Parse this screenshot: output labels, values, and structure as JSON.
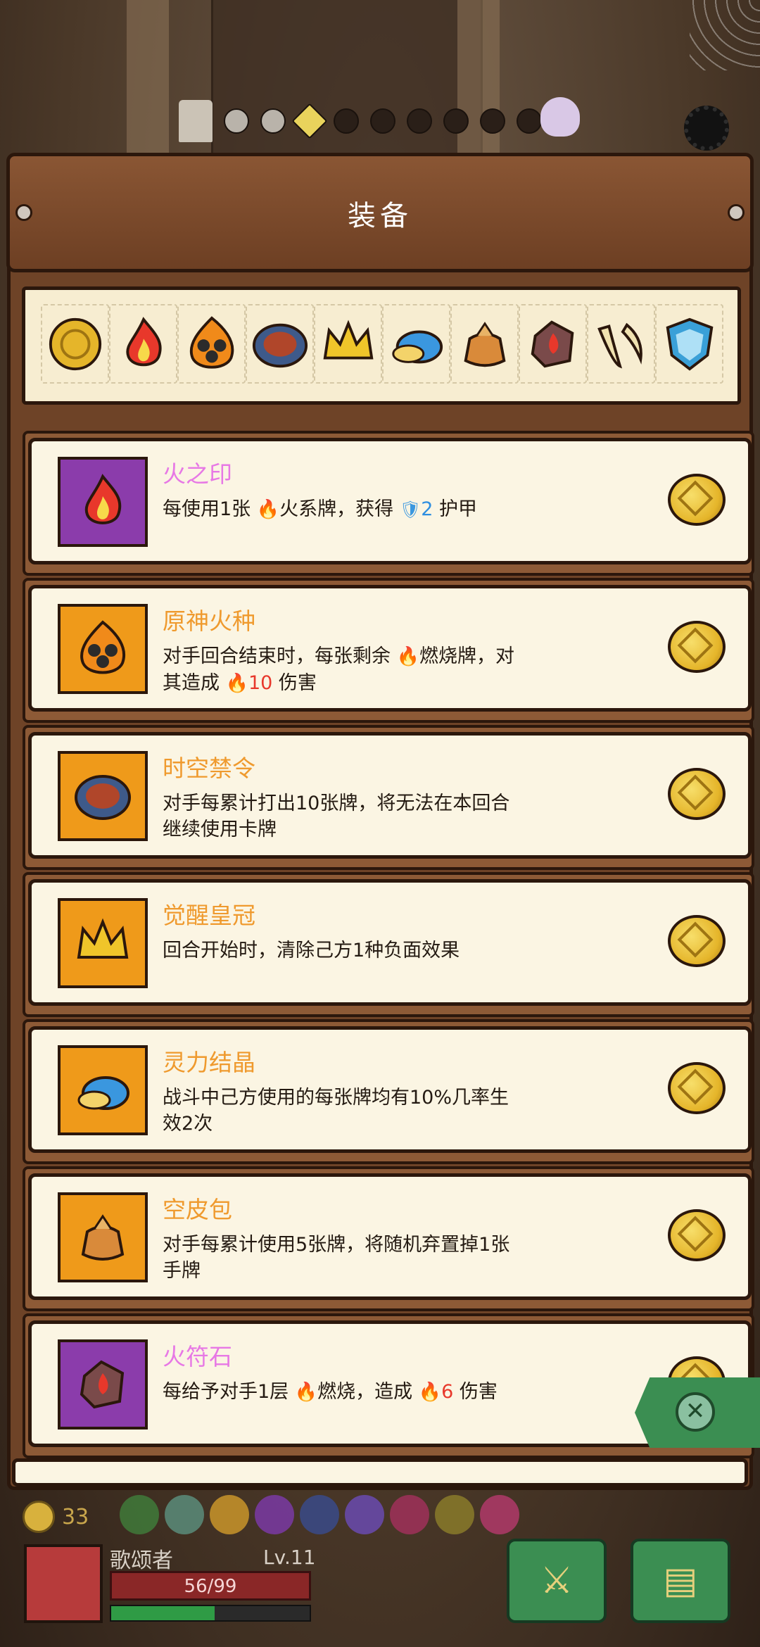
{
  "title": "装备",
  "progress": {
    "dots": [
      "light",
      "light",
      "gold",
      "dark",
      "dark",
      "dark",
      "dark",
      "dark",
      "dark"
    ]
  },
  "strip_items": [
    {
      "name": "gold-seal-icon",
      "color": "#e5b52a"
    },
    {
      "name": "flame-icon",
      "color": "#e8382b"
    },
    {
      "name": "flame-seed-icon",
      "color": "#f08a1a"
    },
    {
      "name": "time-disc-icon",
      "color": "#3e5a8a"
    },
    {
      "name": "crown-icon",
      "color": "#f0c52a"
    },
    {
      "name": "crystal-icon",
      "color": "#3a97df"
    },
    {
      "name": "leather-bag-icon",
      "color": "#d98a3a"
    },
    {
      "name": "fire-rune-stone-icon",
      "color": "#7a4a4a"
    },
    {
      "name": "fang-icon",
      "color": "#f0e2b0"
    },
    {
      "name": "blue-shield-icon",
      "color": "#3aa0d8"
    }
  ],
  "items": [
    {
      "name": "火之印",
      "frame": "purple",
      "desc_parts": [
        "每使用1张 ",
        "🔥",
        "火系牌，获得 ",
        "🛡",
        "2",
        " 护甲"
      ],
      "icon": "flame-icon"
    },
    {
      "name": "原神火种",
      "frame": "orange",
      "desc_parts": [
        "对手回合结束时，每张剩余 ",
        "🔥",
        "燃烧牌，对其造成 ",
        "🔥",
        "10",
        " 伤害"
      ],
      "icon": "flame-seed-icon"
    },
    {
      "name": "时空禁令",
      "frame": "orange",
      "desc_parts": [
        "对手每累计打出10张牌，将无法在本回合继续使用卡牌"
      ],
      "icon": "time-disc-icon"
    },
    {
      "name": "觉醒皇冠",
      "frame": "orange",
      "desc_parts": [
        "回合开始时，清除己方1种负面效果"
      ],
      "icon": "crown-icon"
    },
    {
      "name": "灵力结晶",
      "frame": "orange",
      "desc_parts": [
        "战斗中己方使用的每张牌均有10%几率生效2次"
      ],
      "icon": "crystal-icon"
    },
    {
      "name": "空皮包",
      "frame": "orange",
      "desc_parts": [
        "对手每累计使用5张牌，将随机弃置掉1张手牌"
      ],
      "icon": "leather-bag-icon"
    },
    {
      "name": "火符石",
      "frame": "purple",
      "desc_parts": [
        "每给予对手1层 ",
        "🔥",
        "燃烧，造成 ",
        "🔥",
        "6",
        " 伤害"
      ],
      "icon": "fire-rune-stone-icon"
    }
  ],
  "hud": {
    "coins": "33",
    "player_name": "歌颂者",
    "level": "Lv.11",
    "hp": "56/99",
    "xp_fraction": 0.52
  },
  "colors": {
    "purple_name": "#e778e5",
    "orange_name": "#ef9a2e",
    "panel": "#6e4327",
    "card": "#fbf5e3"
  }
}
